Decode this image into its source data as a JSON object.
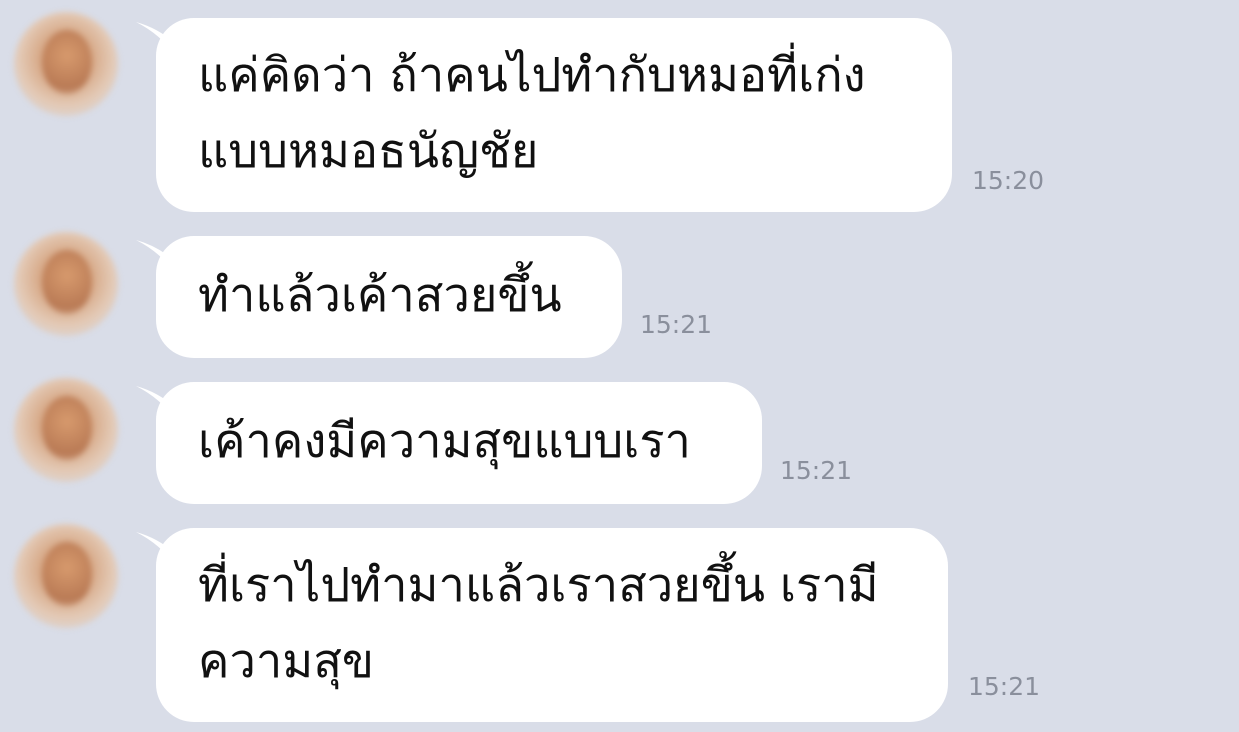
{
  "messages": [
    {
      "lines": [
        "แค่คิดว่า ถ้าคนไปทำกับหมอที่เก่ง",
        "แบบหมอธนัญชัย"
      ],
      "time": "15:20"
    },
    {
      "lines": [
        "ทำแล้วเค้าสวยขึ้น"
      ],
      "time": "15:21"
    },
    {
      "lines": [
        "เค้าคงมีความสุขแบบเรา"
      ],
      "time": "15:21"
    },
    {
      "lines": [
        "ที่เราไปทำมาแล้วเราสวยขึ้น เรามี",
        "ความสุข"
      ],
      "time": "15:21"
    }
  ],
  "colors": {
    "background": "#d9dde8",
    "bubble": "#ffffff",
    "text": "#111111",
    "timestamp": "#8a8f9c"
  },
  "icons": {
    "avatar": "contact-avatar-blurred"
  }
}
